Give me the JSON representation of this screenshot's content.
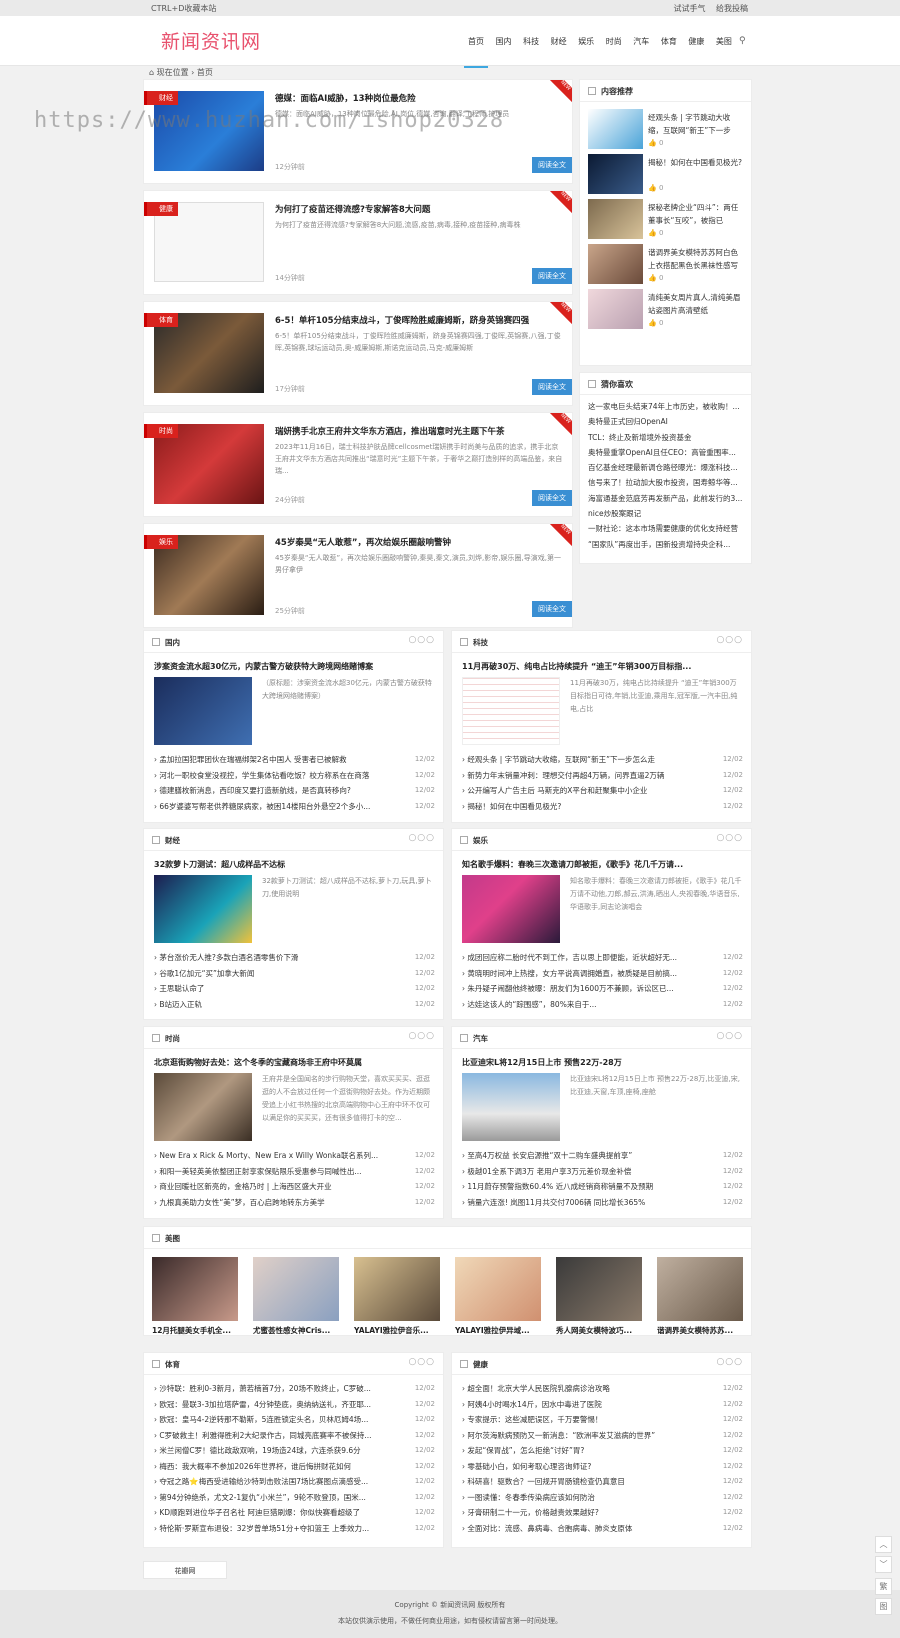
{
  "topbar": {
    "left": "CTRL+D收藏本站",
    "right1": "试试手气",
    "right2": "给我投稿"
  },
  "site": {
    "logo": "新闻资讯网"
  },
  "nav": [
    "首页",
    "国内",
    "科技",
    "财经",
    "娱乐",
    "时尚",
    "汽车",
    "体育",
    "健康",
    "美图"
  ],
  "crumb": "现在位置 › 首页",
  "watermark": "https://www.huzhan.com/ishop20328",
  "articles": [
    {
      "tag": "财经",
      "title": "德媒：面临AI威胁，13种岗位最危险",
      "desc": "德媒：面临AI威胁，13种岗位最危险,AI,岗位,德媒,咨询,翻译,工程师,护理员",
      "time": "12分钟前",
      "btn": "阅读全文"
    },
    {
      "tag": "健康",
      "title": "为何打了疫苗还得流感?专家解答8大问题",
      "desc": "为何打了疫苗还得流感?专家解答8大问题,流感,疫苗,病毒,接种,疫苗接种,病毒株",
      "time": "14分钟前",
      "btn": "阅读全文"
    },
    {
      "tag": "体育",
      "title": "6-5！单杆105分结束战斗，丁俊晖险胜威廉姆斯，跻身英锦赛四强",
      "desc": "6-5！单杆105分结束战斗，丁俊晖险胜威廉姆斯，跻身英锦赛四强,丁俊晖,英锦赛,八强,丁俊晖,英锦赛,球坛运动员,奥-威廉姆斯,斯诺克运动员,马克-威廉姆斯",
      "time": "17分钟前",
      "btn": "阅读全文"
    },
    {
      "tag": "时尚",
      "title": "瑞妍携手北京王府井文华东方酒店，推出瑞意时光主题下午茶",
      "desc": "2023年11月16日，瑞士科技护肤品牌cellcosmet瑞妍携手时尚美与品质的追求，携手北京王府井文华东方酒店共同推出“瑞意时光”主题下午茶，于奢华之巅打造别样的高端品鉴，来自瑞...",
      "time": "24分钟前",
      "btn": "阅读全文"
    },
    {
      "tag": "娱乐",
      "title": "45岁秦昊“无人敢惹”，再次给娱乐圈敲响警钟",
      "desc": "45岁秦昊“无人敢惹”，再次给娱乐圈敲响警钟,秦昊,秦文,演员,刘烨,影帝,娱乐圈,导演戏,第一男仔拿伊",
      "time": "25分钟前",
      "btn": "阅读全文"
    }
  ],
  "sidebar": {
    "rec_title": "内容推荐",
    "recs": [
      {
        "title": "经观头条 | 字节跳动大收缩，互联网“新王”下一步",
        "likes": "0"
      },
      {
        "title": "揭秘！如何在中国看见极光?",
        "likes": "0"
      },
      {
        "title": "探秘老牌企业“四斗”：两任董事长“互咬”，被指已",
        "likes": "0"
      },
      {
        "title": "谐调界美女模特苏苏阿白色上衣搭配黑色长黑袜性感写",
        "likes": "0"
      },
      {
        "title": "清纯美女周片真人,清纯美眉站姿图片高清壁纸",
        "likes": "0"
      }
    ],
    "guess_title": "猜你喜欢",
    "guess": [
      "这一家电巨头结束74年上市历史，被收购！...",
      "奥特曼正式回归OpenAI",
      "TCL：终止及新增境外投资基金",
      "奥特曼重掌OpenAI且任CEO：高管重围率...",
      "百亿基金经理最新调仓路径曝光：爆涨科技...",
      "信号来了！拉动加大股市投资，国寿鲸华等...",
      "海富通基金范庭芳再发新产品，此前发行的3...",
      "nice炒股案跟记",
      "一财社论：这本市场需要健康的优化支持经营",
      "“国家队”再度出手，国新投资增持央企科..."
    ]
  },
  "sections": [
    {
      "name": "国内",
      "title": "涉案资金流水超30亿元，内蒙古警方破获特大跨境网络赌博案",
      "desc": "（原标题：涉案资金流水超30亿元，内蒙古警方破获特大跨境网络赌博案）",
      "items": [
        {
          "t": "孟加拉国犯罪团伙在瑞福绑架2名中国人 受害者已被解救",
          "d": "12/02"
        },
        {
          "t": "河北一职校食堂没视控，学生集体钻看吃饭？校方称系在在商落",
          "d": "12/02"
        },
        {
          "t": "德建膳枚新消息，西印度又要打造新航线，是否真转移向?",
          "d": "12/02"
        },
        {
          "t": "66岁婆婆写帮老供养糖尿病家，被困14楼阳台外悬空2个多小...",
          "d": "12/02"
        }
      ]
    },
    {
      "name": "科技",
      "title": "11月再破30万、纯电占比持续提升 “迪王”年销300万目标指...",
      "desc": "11月再破30万，纯电占比持续提升 “迪王”年销300万目标指日可待,年销,比亚迪,乘用车,冠军版,一汽丰田,纯电,占比",
      "items": [
        {
          "t": "经观头条 | 字节跳动大收缩，互联网“新王”下一步怎么走",
          "d": "12/02"
        },
        {
          "t": "新势力年末销量冲刺：理想交付再超4万辆，问界直逼2万辆",
          "d": "12/02"
        },
        {
          "t": "公开编写人广告主后 马斯克的X平台和赶聚集中小企业",
          "d": "12/02"
        },
        {
          "t": "揭秘！如何在中国看见极光?",
          "d": "12/02"
        }
      ]
    },
    {
      "name": "财经",
      "title": "32款萝卜刀测试：超八成样品不达标",
      "desc": "32款萝卜刀测试：超八成样品不达标,萝卜刀,玩具,萝卜刀,使用说明",
      "items": [
        {
          "t": "茅台涨价无人推?多款白酒名酒零售价下滑",
          "d": "12/02"
        },
        {
          "t": "谷歌1亿加元“买”加拿大新闻",
          "d": "12/02"
        },
        {
          "t": "王思聪认命了",
          "d": "12/02"
        },
        {
          "t": "B站迈入正轨",
          "d": "12/02"
        }
      ]
    },
    {
      "name": "娱乐",
      "title": "知名歌手爆料：春晚三次邀请刀郎被拒，《歌手》花几千万请...",
      "desc": "知名歌手爆料：春晚三次邀请刀郎被拒，《歌手》花几千万请不动他,刀郎,郝云,洪涛,晒出人,央视春晚,华语音乐,华语歌手,同志论演唱会",
      "items": [
        {
          "t": "成团回应称二胎时代不到工作，吉以思上即便能，近状超好无...",
          "d": "12/02"
        },
        {
          "t": "黄晓明时间冲上热搜，女方平说高调拥婚直，被质疑是目前搞...",
          "d": "12/02"
        },
        {
          "t": "朱丹疑子闹翻他终被曝：朋友们为1600万不兼顾，诉讼区已...",
          "d": "12/02"
        },
        {
          "t": "达娃这该人的“踪围感”，80%来自于...",
          "d": "12/02"
        }
      ]
    },
    {
      "name": "时尚",
      "title": "北京逛街购物好去处：这个冬季的宝藏商场非王府中环莫属",
      "desc": "王府井是全国闻名的步行购物天堂，喜欢买买买、逛逛逛的人不会放过任何一个逛街购物好去处。作为近期颇受追上小红书热搜的北京高端购物中心王府中环不仅可以满足你的买买买，还有很多值得打卡的空...",
      "items": [
        {
          "t": "New Era x Rick & Morty、New Era x Willy Wonka联名系列...",
          "d": "12/02"
        },
        {
          "t": "和阳一美轻英美依整团正射享家保贴限乐受惠参与同喊性出...",
          "d": "12/02"
        },
        {
          "t": "商业回暖社区新亮的，金格乃时 | 上海西区盛大开业",
          "d": "12/02"
        },
        {
          "t": "九根真美助力女性“美”梦，百心启跨地转东方美学",
          "d": "12/02"
        }
      ]
    },
    {
      "name": "汽车",
      "title": "比亚迪宋L将12月15日上市 预售22万-28万",
      "desc": "比亚迪宋L将12月15日上市 预售22万-28万,比亚迪,宋,比亚迪,天窗,车顶,座椅,座舱",
      "items": [
        {
          "t": "至高4万权益 长安启源推“双十二购车盛典提前享”",
          "d": "12/02"
        },
        {
          "t": "极越01全系下调3万 老用户享3万元差价现金补偿",
          "d": "12/02"
        },
        {
          "t": "11月蔚存预警指数60.4% 近八成经销商称销量不及预期",
          "d": "12/02"
        },
        {
          "t": "销量六连涨! 岚图11月共交付7006辆 同比增长365%",
          "d": "12/02"
        }
      ]
    },
    {
      "name": "体育",
      "items": [
        {
          "t": "沙特联：胜利0-3新月，萧若楠首7分，20场不败终止，C罗破...",
          "d": "12/02"
        },
        {
          "t": "欧冠：曼联3-3加拉塔萨雷，4分钟垫底，奥纳纳送礼，齐亚耶...",
          "d": "12/02"
        },
        {
          "t": "欧冠：皇马4-2逆转那不勒斯，5连胜锁定头名，贝林厄姆4场...",
          "d": "12/02"
        },
        {
          "t": "C罗破救主！利雅得胜利2大纪录作古，同城亮底赛率不被保持...",
          "d": "12/02"
        },
        {
          "t": "米兰闲僧C罗！德比政敌双响，19场造24球，六连杀获9.6分",
          "d": "12/02"
        },
        {
          "t": "梅西：我大概率不参加2026年世界杯，谁后悔拼财花如何",
          "d": "12/02"
        },
        {
          "t": "夺冠之路⭐梅西受进输给沙特到击败法国7场比赛图点滴感受...",
          "d": "12/02"
        },
        {
          "t": "第94分钟绝杀，尤文2-1复仇“小米兰”，9轮不败登顶，国米...",
          "d": "12/02"
        },
        {
          "t": "KD顺跑到进位华子召名社 阿迪巨猎刷爆：你似快赛看超级了",
          "d": "12/02"
        },
        {
          "t": "特伦斯·罗斯宣布退役：32岁曾单场51分+夺扣篮王 上季效力...",
          "d": "12/02"
        }
      ]
    },
    {
      "name": "健康",
      "items": [
        {
          "t": "超全面！北京大学人民医院乳腺病诊治攻略",
          "d": "12/02"
        },
        {
          "t": "阿姨4小时喝水14斤，因水中毒进了医院",
          "d": "12/02"
        },
        {
          "t": "专家提示：这些减肥误区，千万要警惕！",
          "d": "12/02"
        },
        {
          "t": "阿尔茨海默病预防又一新消息：“欧洲率发艾滋病的世界”",
          "d": "12/02"
        },
        {
          "t": "发起“保胃战”，怎么拒绝“讨好”胃?",
          "d": "12/02"
        },
        {
          "t": "零基础小白，如何考取心理咨询师证?",
          "d": "12/02"
        },
        {
          "t": "科研喜！驱数合？一回规开胃肠镜检查仍真意目",
          "d": "12/02"
        },
        {
          "t": "一图读懂：冬春季传染病应该如何防治",
          "d": "12/02"
        },
        {
          "t": "牙膏研制二十一元，价格越贵效果越好?",
          "d": "12/02"
        },
        {
          "t": "全面对比：流感、鼻病毒、合胞病毒、肺炎支原体",
          "d": "12/02"
        }
      ]
    }
  ],
  "meitu": {
    "name": "美图",
    "items": [
      "12月托腿美女手机全...",
      "尤蜜荟性感女神Cris...",
      "YALAYI雅拉伊音乐...",
      "YALAYI雅拉伊异域...",
      "秀人网美女模特波巧...",
      "谐调界美女模特苏苏..."
    ]
  },
  "footer": {
    "link": "花瓣网",
    "copy": "Copyright © 新闻资讯网 版权所有",
    "note": "本站仅供演示使用，不做任何商业用途，如有侵权请留言第一时间处理。"
  },
  "float": [
    "︿",
    "﹀",
    "繁",
    "图"
  ]
}
